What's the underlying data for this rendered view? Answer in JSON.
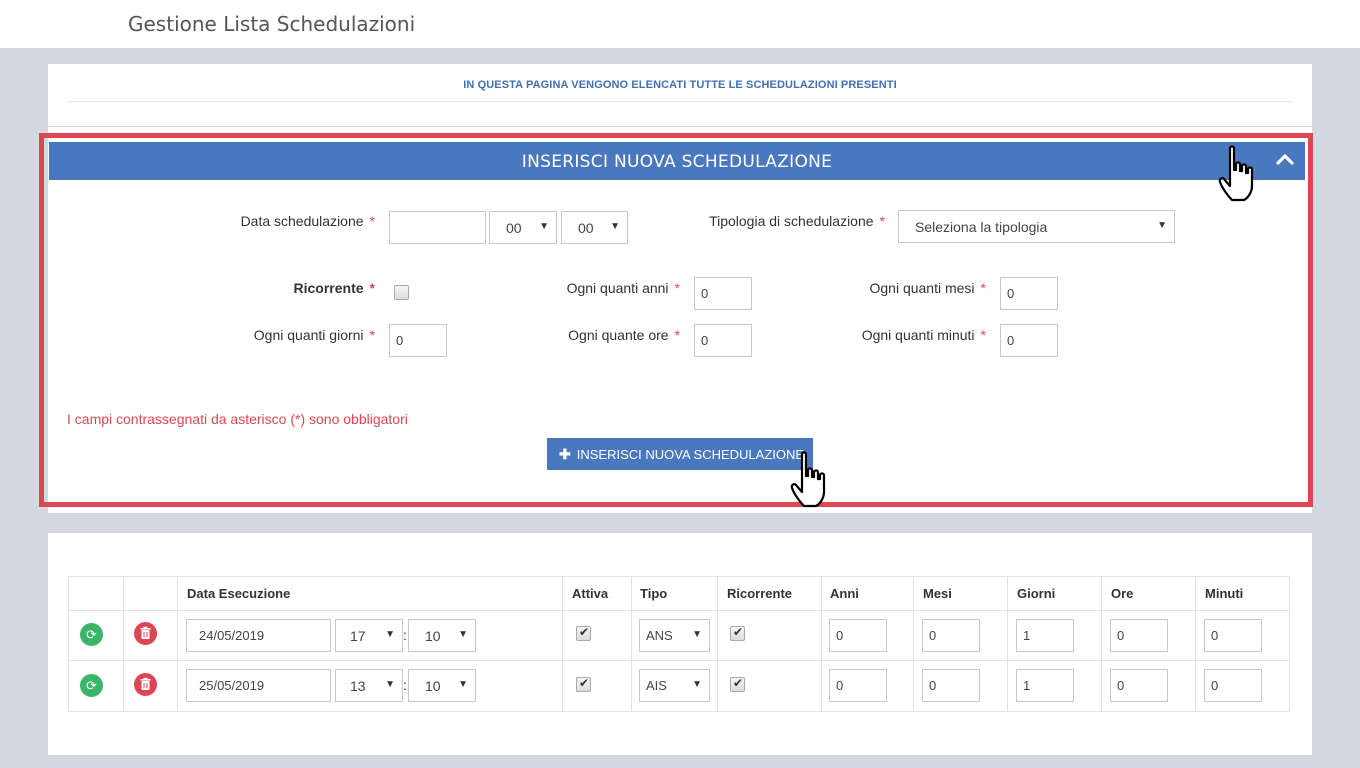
{
  "header": {
    "title": "Gestione Lista Schedulazioni"
  },
  "info": {
    "text": "IN QUESTA PAGINA VENGONO ELENCATI TUTTE LE SCHEDULAZIONI PRESENTI"
  },
  "form": {
    "title": "INSERISCI NUOVA SCHEDULAZIONE",
    "labels": {
      "data": "Data schedulazione",
      "tipologia": "Tipologia di schedulazione",
      "ricorrente": "Ricorrente",
      "anni": "Ogni quanti anni",
      "mesi": "Ogni quanti mesi",
      "giorni": "Ogni quanti giorni",
      "ore": "Ogni quante ore",
      "minuti": "Ogni quanti minuti"
    },
    "required_mark": "*",
    "values": {
      "data": "",
      "hour": "00",
      "minute": "00",
      "tipologia": "Seleziona la tipologia",
      "ricorrente": false,
      "anni": "0",
      "mesi": "0",
      "giorni": "0",
      "ore": "0",
      "minuti": "0"
    },
    "required_note": "I campi contrassegnati da asterisco (*) sono obbligatori",
    "submit_label": "INSERISCI NUOVA SCHEDULAZIONE"
  },
  "table": {
    "headers": [
      "Data Esecuzione",
      "Attiva",
      "Tipo",
      "Ricorrente",
      "Anni",
      "Mesi",
      "Giorni",
      "Ore",
      "Minuti"
    ],
    "rows": [
      {
        "date": "24/05/2019",
        "hour": "17",
        "minute": "10",
        "attiva": true,
        "tipo": "ANS",
        "ricorrente": true,
        "anni": "0",
        "mesi": "0",
        "giorni": "1",
        "ore": "0",
        "minuti": "0"
      },
      {
        "date": "25/05/2019",
        "hour": "13",
        "minute": "10",
        "attiva": true,
        "tipo": "AIS",
        "ricorrente": true,
        "anni": "0",
        "mesi": "0",
        "giorni": "1",
        "ore": "0",
        "minuti": "0"
      }
    ],
    "time_separator": ":"
  },
  "icons": {
    "dropdown": "caret-down-icon",
    "collapse": "chevron-up-icon",
    "refresh": "refresh-icon",
    "delete": "trash-icon",
    "plus": "plus-icon",
    "cursor": "hand-pointer-icon"
  },
  "colors": {
    "accent": "#4a78be",
    "danger": "#e04554",
    "success": "#3bb56a",
    "highlight": "#e04554"
  }
}
